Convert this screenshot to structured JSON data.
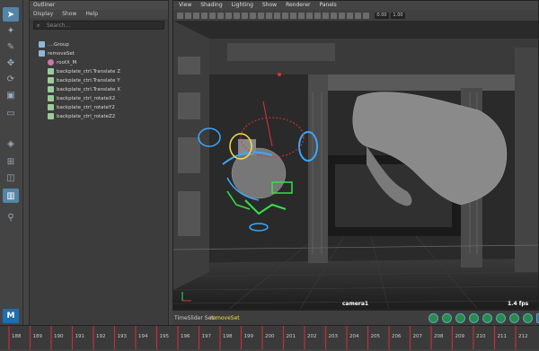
{
  "outliner": {
    "title": "Outliner",
    "menu": [
      "Display",
      "Show",
      "Help"
    ],
    "search_placeholder": "Search...",
    "rows": [
      {
        "label": "...:Group",
        "indent": 0
      },
      {
        "label": "removeSet",
        "indent": 0
      },
      {
        "label": "rootX_M",
        "indent": 1
      },
      {
        "label": "backplate_ctrl.Translate Z",
        "indent": 1
      },
      {
        "label": "backplate_ctrl.Translate Y",
        "indent": 1
      },
      {
        "label": "backplate_ctrl.Translate X",
        "indent": 1
      },
      {
        "label": "backplate_ctrl_rotateX2",
        "indent": 1
      },
      {
        "label": "backplate_ctrl_rotateY2",
        "indent": 1
      },
      {
        "label": "backplate_ctrl_rotateZ2",
        "indent": 1
      }
    ]
  },
  "viewport": {
    "menu": [
      "View",
      "Shading",
      "Lighting",
      "Show",
      "Renderer",
      "Panels"
    ],
    "camera_label": "camera1",
    "fps": "1.4 fps",
    "field_values": [
      "0.00",
      "1.00"
    ]
  },
  "status": {
    "timeslider_label": "TimeSlider Set :",
    "timeslider_value": "removeSet"
  },
  "timeline": {
    "ticks": [
      "188",
      "189",
      "190",
      "191",
      "192",
      "193",
      "194",
      "195",
      "196",
      "197",
      "198",
      "199",
      "200",
      "201",
      "202",
      "203",
      "204",
      "205",
      "206",
      "207",
      "208",
      "209",
      "210",
      "211",
      "212"
    ]
  },
  "colors": {
    "accent": "#5285a6",
    "rig_blue": "#3aa8ff",
    "rig_green": "#38e04a",
    "rig_red": "#e0303a",
    "rig_yellow": "#f0e040",
    "keyframe": "#c0303a"
  }
}
